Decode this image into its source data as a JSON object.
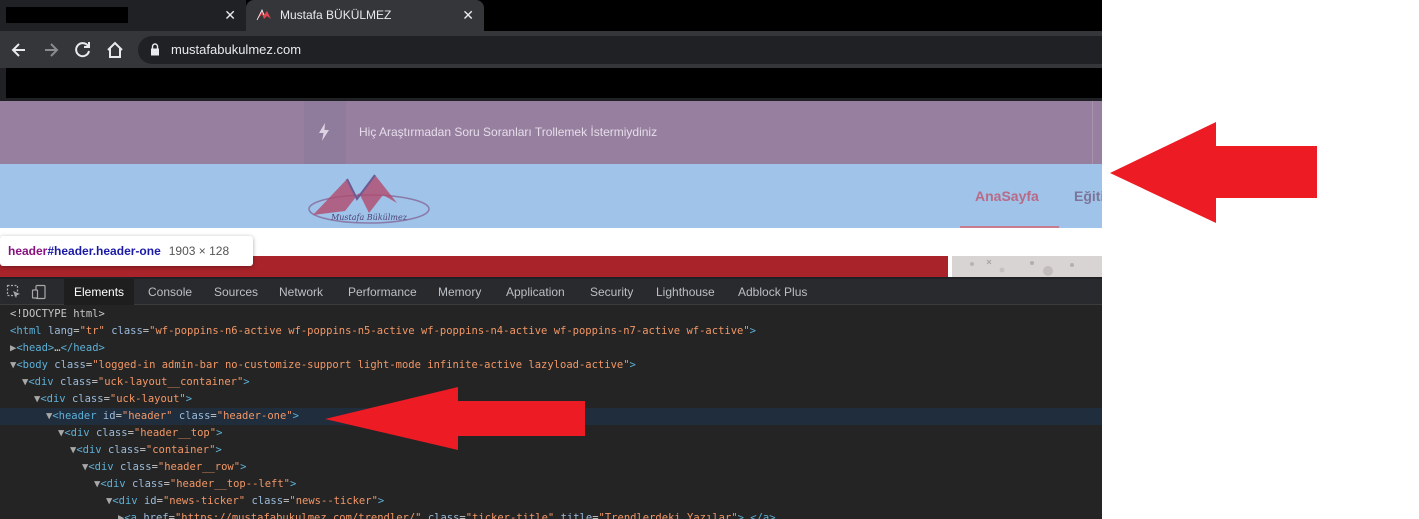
{
  "browser": {
    "tabs": [
      {
        "title": "",
        "redacted": true,
        "close": "✕"
      },
      {
        "title": "Mustafa BÜKÜLMEZ",
        "close": "✕",
        "active": true
      }
    ],
    "url": "mustafabukulmez.com"
  },
  "page": {
    "ticker_text": "Hiç Araştırmadan Soru Soranları Trollemek İstermiydiniz",
    "logo_text": "Mustafa Bükülmez",
    "nav": {
      "home": "AnaSayfa",
      "next": "Eğiti"
    }
  },
  "tooltip": {
    "tag": "header",
    "selector": "#header.header-one",
    "size": "1903 × 128"
  },
  "devtools": {
    "tabs": [
      "Elements",
      "Console",
      "Sources",
      "Network",
      "Performance",
      "Memory",
      "Application",
      "Security",
      "Lighthouse",
      "Adblock Plus"
    ],
    "active_tab": "Elements",
    "lines": [
      {
        "tri": "",
        "tag": "<!DOCTYPE html>"
      },
      {
        "tri": "",
        "open": "<html",
        "attrs": [
          [
            "lang",
            "\"tr\""
          ],
          [
            "class",
            "\"wf-poppins-n6-active wf-poppins-n5-active wf-poppins-n4-active wf-poppins-n7-active wf-active\""
          ]
        ],
        "close": ">"
      },
      {
        "tri": "▶",
        "open": "<head>",
        "mid": "…",
        "close": "</head>"
      },
      {
        "tri": "▼",
        "open": "<body",
        "attrs": [
          [
            "class",
            "\"logged-in admin-bar no-customize-support light-mode infinite-active lazyload-active\""
          ]
        ],
        "close": ">"
      },
      {
        "tri": "▼",
        "open": "<div",
        "attrs": [
          [
            "class",
            "\"uck-layout__container\""
          ]
        ],
        "close": ">"
      },
      {
        "tri": "▼",
        "open": "<div",
        "attrs": [
          [
            "class",
            "\"uck-layout\""
          ]
        ],
        "close": ">"
      },
      {
        "tri": "▼",
        "open": "<header",
        "attrs": [
          [
            "id",
            "\"header\""
          ],
          [
            "class",
            "\"header-one\""
          ]
        ],
        "close": ">"
      },
      {
        "tri": "▼",
        "open": "<div",
        "attrs": [
          [
            "class",
            "\"header__top\""
          ]
        ],
        "close": ">"
      },
      {
        "tri": "▼",
        "open": "<div",
        "attrs": [
          [
            "class",
            "\"container\""
          ]
        ],
        "close": ">"
      },
      {
        "tri": "▼",
        "open": "<div",
        "attrs": [
          [
            "class",
            "\"header__row\""
          ]
        ],
        "close": ">"
      },
      {
        "tri": "▼",
        "open": "<div",
        "attrs": [
          [
            "class",
            "\"header__top--left\""
          ]
        ],
        "close": ">"
      },
      {
        "tri": "▼",
        "open": "<div",
        "attrs": [
          [
            "id",
            "\"news-ticker\""
          ],
          [
            "class",
            "\"news--ticker\""
          ]
        ],
        "close": ">"
      },
      {
        "tri": "▶",
        "open": "<a",
        "attrs": [
          [
            "href",
            "\"https://mustafabukulmez.com/trendler/\""
          ],
          [
            "class",
            "\"ticker-title\""
          ],
          [
            "title",
            "\"Trendlerdeki Yazılar\""
          ]
        ],
        "close": ">…</a>"
      }
    ]
  },
  "colors": {
    "ticker_bg": "#97809f",
    "header_bg": "#9fc3e9",
    "accent_red": "#ed1c24",
    "devtools_bg": "#242424"
  }
}
